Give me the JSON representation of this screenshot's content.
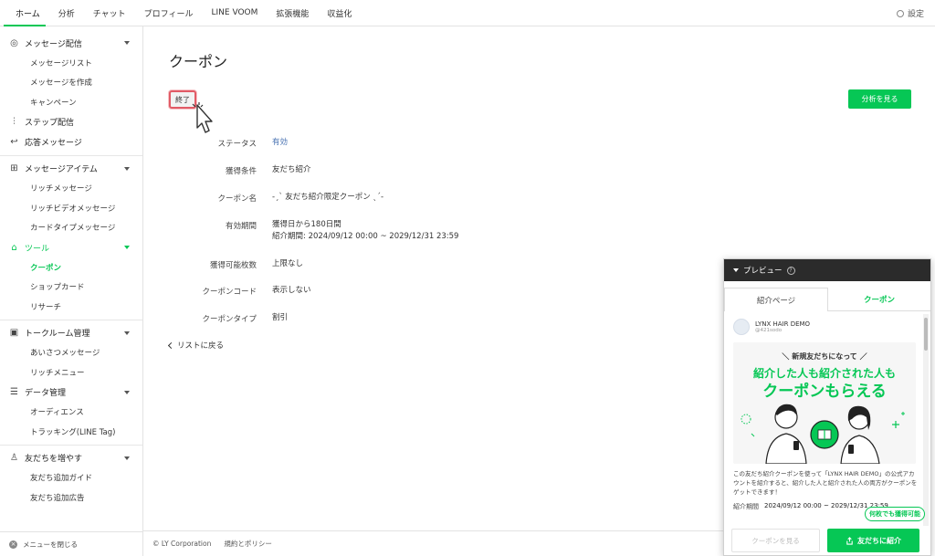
{
  "topnav": {
    "tabs": [
      "ホーム",
      "分析",
      "チャット",
      "プロフィール",
      "LINE VOOM",
      "拡張機能",
      "収益化"
    ],
    "active": "ホーム",
    "settings_label": "設定"
  },
  "sidebar": {
    "sections": [
      {
        "label": "メッセージ配信",
        "icon": "broadcast-icon",
        "items": [
          "メッセージリスト",
          "メッセージを作成",
          "キャンペーン"
        ]
      },
      {
        "label": "ステップ配信",
        "icon": "step-icon",
        "items": []
      },
      {
        "label": "応答メッセージ",
        "icon": "reply-icon",
        "items": []
      },
      {
        "label": "メッセージアイテム",
        "icon": "message-item-icon",
        "items": [
          "リッチメッセージ",
          "リッチビデオメッセージ",
          "カードタイプメッセージ"
        ]
      },
      {
        "label": "ツール",
        "icon": "shop-icon",
        "items": [
          "クーポン",
          "ショップカード",
          "リサーチ"
        ]
      },
      {
        "label": "トークルーム管理",
        "icon": "talkroom-icon",
        "items": [
          "あいさつメッセージ",
          "リッチメニュー"
        ]
      },
      {
        "label": "データ管理",
        "icon": "database-icon",
        "items": [
          "オーディエンス",
          "トラッキング(LINE Tag)"
        ]
      },
      {
        "label": "友だちを増やす",
        "icon": "add-friend-icon",
        "items": [
          "友だち追加ガイド",
          "友だち追加広告"
        ]
      }
    ],
    "active_item": "クーポン",
    "footer_label": "メニューを閉じる"
  },
  "main": {
    "title": "クーポン",
    "status_button": "終了",
    "analyze_button": "分析を見る",
    "fields": [
      {
        "label": "ステータス",
        "value": "有効"
      },
      {
        "label": "獲得条件",
        "value": "友だち紹介"
      },
      {
        "label": "クーポン名",
        "value": "-ˏˋ 友だち紹介限定クーポン ˎˊ-"
      },
      {
        "label": "有効期間",
        "value": "獲得日から180日間",
        "value2": "紹介期間: 2024/09/12 00:00 ~ 2029/12/31 23:59"
      },
      {
        "label": "獲得可能枚数",
        "value": "上限なし"
      },
      {
        "label": "クーポンコード",
        "value": "表示しない"
      },
      {
        "label": "クーポンタイプ",
        "value": "割引"
      }
    ],
    "back_link": "リストに戻る",
    "footer": {
      "copyright": "© LY Corporation",
      "policy": "規約とポリシー"
    }
  },
  "preview": {
    "header": "プレビュー",
    "tabs": [
      "紹介ページ",
      "クーポン"
    ],
    "account_name": "LYNX HAIR DEMO",
    "account_id": "@421sodo",
    "banner": {
      "line1": "＼ 新規友だちになって ／",
      "line2": "紹介した人も紹介された人も",
      "line3": "クーポンもらえる"
    },
    "description": "この友だち紹介クーポンを使って「LYNX HAIR DEMO」の公式アカウントを紹介すると、紹介した人と紹介された人の両方がクーポンをゲットできます！",
    "period_label": "紹介期間",
    "period_value": "2024/09/12 00:00 ~ 2029/12/31 23:59",
    "bubble": "何枚でも獲得可能",
    "ghost_button": "クーポンを見る",
    "share_button": "友だちに紹介"
  },
  "colors": {
    "accent": "#06c755",
    "highlight": "#e15b66",
    "link": "#4b74b3"
  }
}
